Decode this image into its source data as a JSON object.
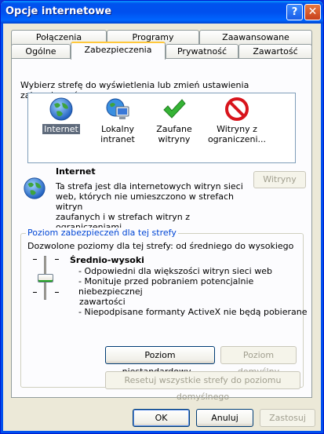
{
  "window": {
    "title": "Opcje internetowe",
    "help_glyph": "?",
    "close_glyph": "✕"
  },
  "tabs_row1": [
    "Połączenia",
    "Programy",
    "Zaawansowane"
  ],
  "tabs_row2": [
    "Ogólne",
    "Zabezpieczenia",
    "Prywatność",
    "Zawartość"
  ],
  "active_tab": "Zabezpieczenia",
  "zones": {
    "prompt": "Wybierz strefę do wyświetlenia lub zmień ustawienia zabezpieczeń.",
    "items": [
      {
        "line1": "Internet",
        "line2": "",
        "icon": "globe-icon",
        "selected": true
      },
      {
        "line1": "Lokalny",
        "line2": "intranet",
        "icon": "computer-icon",
        "selected": false
      },
      {
        "line1": "Zaufane",
        "line2": "witryny",
        "icon": "check-icon",
        "selected": false
      },
      {
        "line1": "Witryny z",
        "line2": "ograniczeni...",
        "icon": "forbidden-icon",
        "selected": false
      }
    ]
  },
  "zone_info": {
    "name": "Internet",
    "desc_lines": [
      "Ta strefa jest dla internetowych witryn sieci",
      "web, których nie umieszczono w strefach witryn",
      "zaufanych i w strefach witryn z ograniczeniami."
    ],
    "sites_button": "Witryny"
  },
  "security_level": {
    "group_label": "Poziom zabezpieczeń dla tej strefy",
    "allowed": "Dozwolone poziomy dla tej strefy: od średniego do wysokiego",
    "level_name": "Średnio-wysoki",
    "bullets": [
      "- Odpowiedni dla większości witryn sieci web",
      "- Monituje przed pobraniem potencjalnie niebezpiecznej",
      "zawartości",
      "- Niepodpisane formanty ActiveX nie będą pobierane"
    ],
    "custom_button": "Poziom niestandardowy...",
    "default_button": "Poziom domyślny",
    "reset_button": "Resetuj wszystkie strefy do poziomu domyślnego"
  },
  "footer": {
    "ok": "OK",
    "cancel": "Anuluj",
    "apply": "Zastosuj"
  }
}
